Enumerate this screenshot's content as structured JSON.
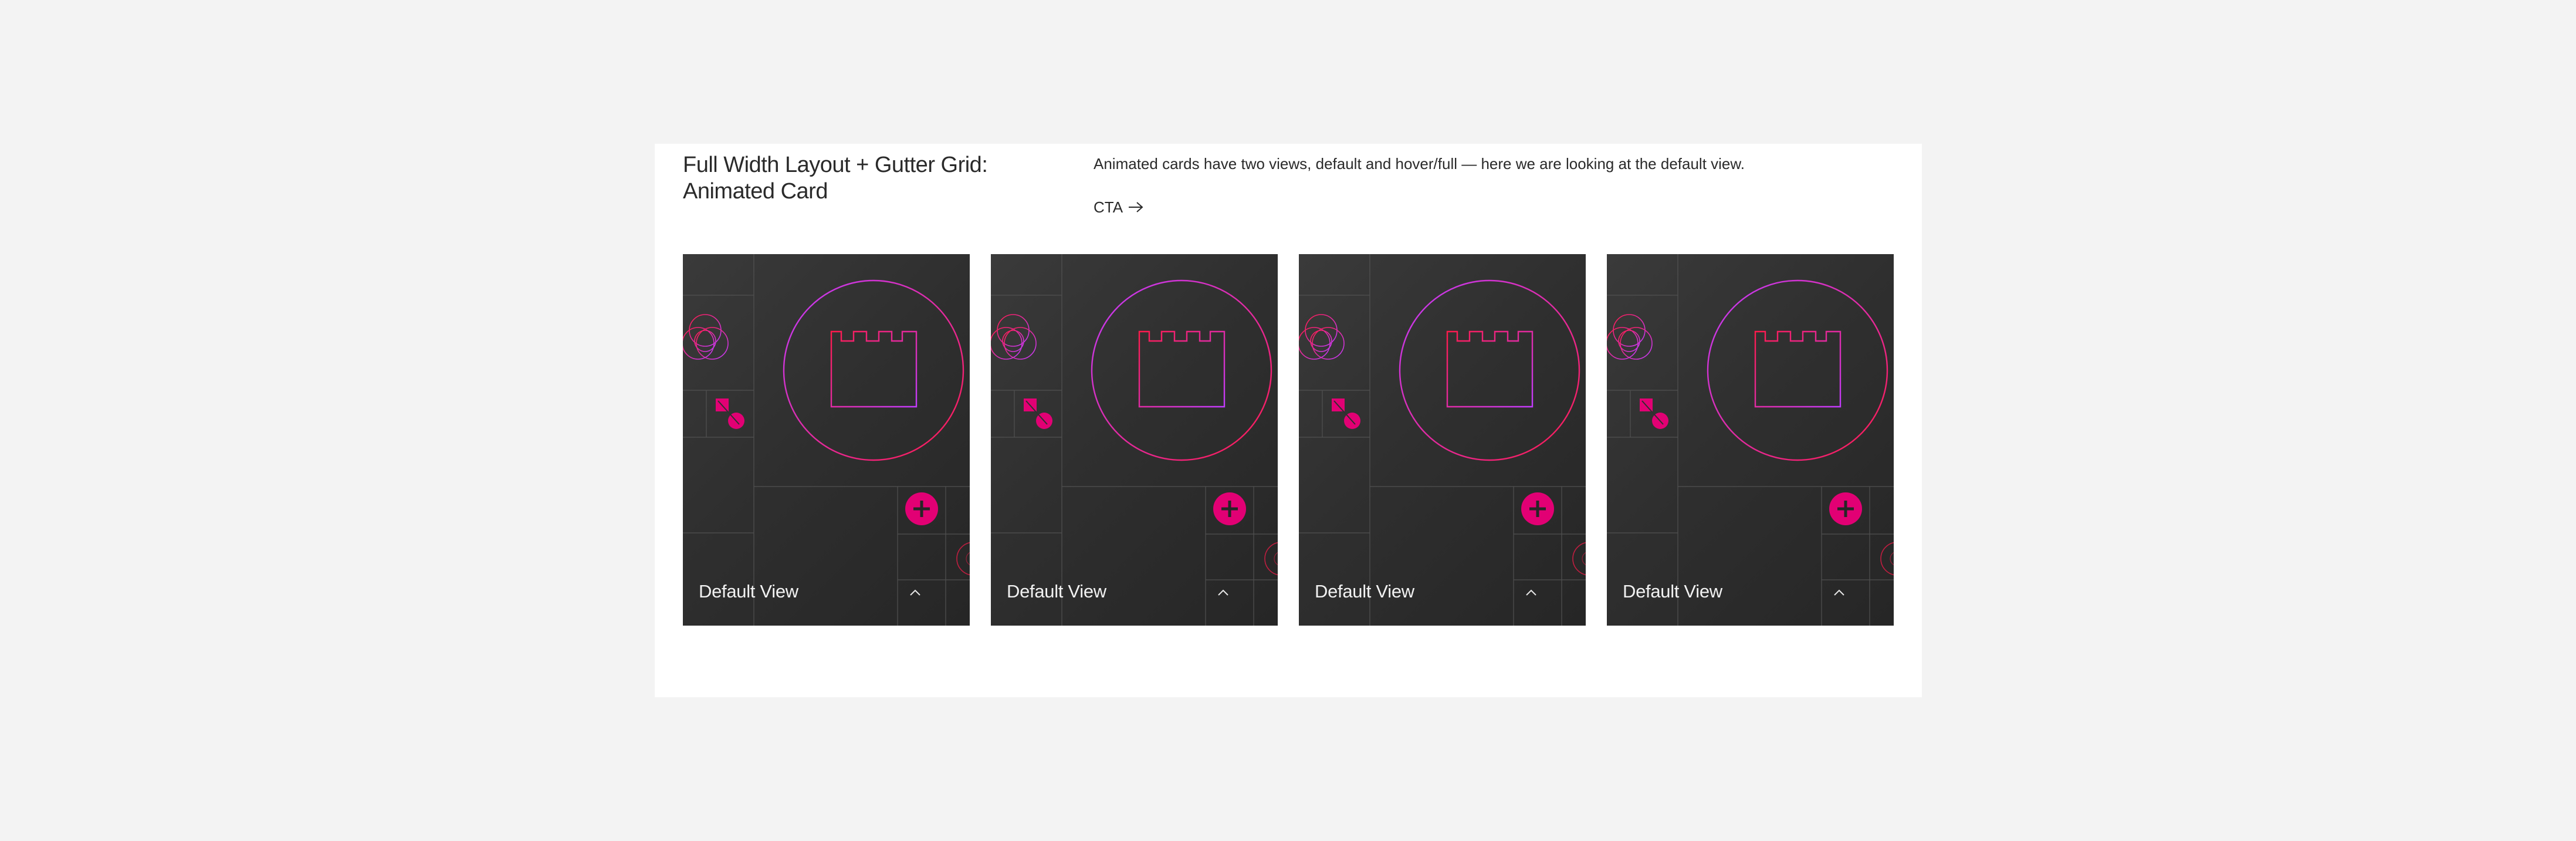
{
  "section": {
    "title": "Full Width Layout + Gutter Grid: Animated Card",
    "description": "Animated cards have two views, default and hover/full — here we are looking at the default view.",
    "cta_label": "CTA"
  },
  "cards": [
    {
      "label": "Default View",
      "icons": [
        "overlapping-circles-icon",
        "tower-icon",
        "plus-icon",
        "chevron-up-icon"
      ]
    },
    {
      "label": "Default View",
      "icons": [
        "overlapping-circles-icon",
        "tower-icon",
        "plus-icon",
        "chevron-up-icon"
      ]
    },
    {
      "label": "Default View",
      "icons": [
        "overlapping-circles-icon",
        "tower-icon",
        "plus-icon",
        "chevron-up-icon"
      ]
    },
    {
      "label": "Default View",
      "icons": [
        "overlapping-circles-icon",
        "tower-icon",
        "plus-icon",
        "chevron-up-icon"
      ]
    }
  ],
  "colors": {
    "page_background": "#f3f3f3",
    "panel_background": "#ffffff",
    "card_background": "#2f2f2f",
    "accent_magenta": "#e20074",
    "accent_red": "#ff1a4a",
    "accent_purple": "#c23cff"
  }
}
